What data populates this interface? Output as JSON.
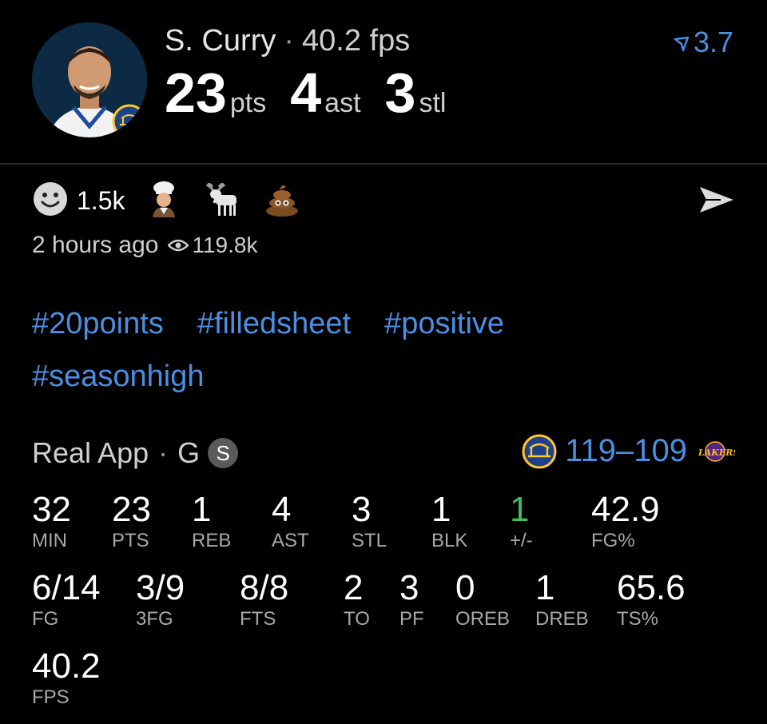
{
  "header": {
    "player_name": "S. Curry",
    "separator": "·",
    "fps_text": "40.2 fps",
    "rating": "3.7",
    "stats": [
      {
        "value": "23",
        "unit": "pts"
      },
      {
        "value": "4",
        "unit": "ast"
      },
      {
        "value": "3",
        "unit": "stl"
      }
    ]
  },
  "reactions": {
    "count": "1.5k",
    "emojis": [
      "smile-icon",
      "chef-icon",
      "goat-icon",
      "poop-icon"
    ]
  },
  "meta": {
    "time": "2 hours ago",
    "views": "119.8k"
  },
  "tags": [
    "#20points",
    "#filledsheet",
    "#positive",
    "#seasonhigh"
  ],
  "source": {
    "app": "Real App",
    "separator": "·",
    "position": "G",
    "badge": "S",
    "score": "119–109"
  },
  "stat_grid": {
    "row1": [
      {
        "value": "32",
        "label": "MIN"
      },
      {
        "value": "23",
        "label": "PTS"
      },
      {
        "value": "1",
        "label": "REB"
      },
      {
        "value": "4",
        "label": "AST"
      },
      {
        "value": "3",
        "label": "STL"
      },
      {
        "value": "1",
        "label": "BLK"
      },
      {
        "value": "1",
        "label": "+/-"
      },
      {
        "value": "42.9",
        "label": "FG%"
      }
    ],
    "row2": [
      {
        "value": "6/14",
        "label": "FG"
      },
      {
        "value": "3/9",
        "label": "3FG"
      },
      {
        "value": "8/8",
        "label": "FTS"
      },
      {
        "value": "2",
        "label": "TO"
      },
      {
        "value": "3",
        "label": "PF"
      },
      {
        "value": "0",
        "label": "OREB"
      },
      {
        "value": "1",
        "label": "DREB"
      },
      {
        "value": "65.6",
        "label": "TS%"
      }
    ],
    "row3": [
      {
        "value": "40.2",
        "label": "FPS"
      }
    ]
  },
  "colors": {
    "accent": "#4a8fe2",
    "positive": "#3fbf5e",
    "background": "#000000"
  }
}
